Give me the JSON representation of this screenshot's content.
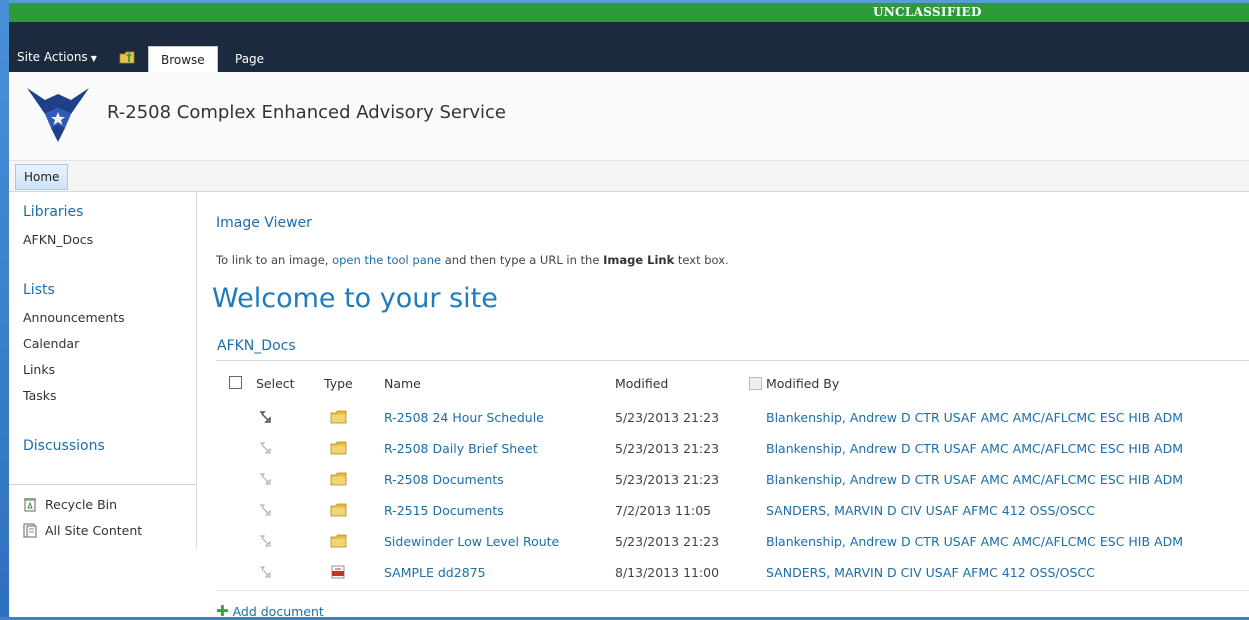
{
  "classification": "UNCLASSIFIED",
  "ribbon": {
    "site_actions": "Site Actions",
    "tabs": [
      {
        "label": "Browse"
      },
      {
        "label": "Page"
      }
    ]
  },
  "header": {
    "site_title": "R-2508 Complex Enhanced Advisory Service"
  },
  "topnav": {
    "home": "Home"
  },
  "quicklaunch": {
    "libraries_heading": "Libraries",
    "libraries": [
      "AFKN_Docs"
    ],
    "lists_heading": "Lists",
    "lists": [
      "Announcements",
      "Calendar",
      "Links",
      "Tasks"
    ],
    "discussions_heading": "Discussions",
    "recycle_bin": "Recycle Bin",
    "all_site_content": "All Site Content"
  },
  "image_viewer": {
    "title": "Image Viewer",
    "hint_prefix": "To link to an image, ",
    "hint_link": "open the tool pane",
    "hint_mid": " and then type a URL in the ",
    "hint_bold": "Image Link",
    "hint_suffix": " text box."
  },
  "welcome": "Welcome to your site",
  "library": {
    "title": "AFKN_Docs",
    "columns": {
      "select": "Select",
      "type": "Type",
      "name": "Name",
      "modified": "Modified",
      "modified_by": "Modified By"
    },
    "rows": [
      {
        "name": "R-2508 24 Hour Schedule",
        "modified": "5/23/2013 21:23",
        "modified_by": "Blankenship, Andrew D CTR USAF AMC AMC/AFLCMC ESC HIB ADM",
        "type": "folder"
      },
      {
        "name": "R-2508 Daily Brief Sheet",
        "modified": "5/23/2013 21:23",
        "modified_by": "Blankenship, Andrew D CTR USAF AMC AMC/AFLCMC ESC HIB ADM",
        "type": "folder"
      },
      {
        "name": "R-2508 Documents",
        "modified": "5/23/2013 21:23",
        "modified_by": "Blankenship, Andrew D CTR USAF AMC AMC/AFLCMC ESC HIB ADM",
        "type": "folder"
      },
      {
        "name": "R-2515 Documents",
        "modified": "7/2/2013 11:05",
        "modified_by": "SANDERS, MARVIN D CIV USAF AFMC 412 OSS/OSCC",
        "type": "folder"
      },
      {
        "name": "Sidewinder Low Level Route",
        "modified": "5/23/2013 21:23",
        "modified_by": "Blankenship, Andrew D CTR USAF AMC AMC/AFLCMC ESC HIB ADM",
        "type": "folder"
      },
      {
        "name": "SAMPLE dd2875",
        "modified": "8/13/2013 11:00",
        "modified_by": "SANDERS, MARVIN D CIV USAF AFMC 412 OSS/OSCC",
        "type": "pdf"
      }
    ],
    "add_document": "Add document"
  },
  "colors": {
    "classification_bar": "#2e9a3b",
    "ribbon": "#1b2a3e",
    "link": "#1b6ea8",
    "folder": "#e8b93a"
  }
}
